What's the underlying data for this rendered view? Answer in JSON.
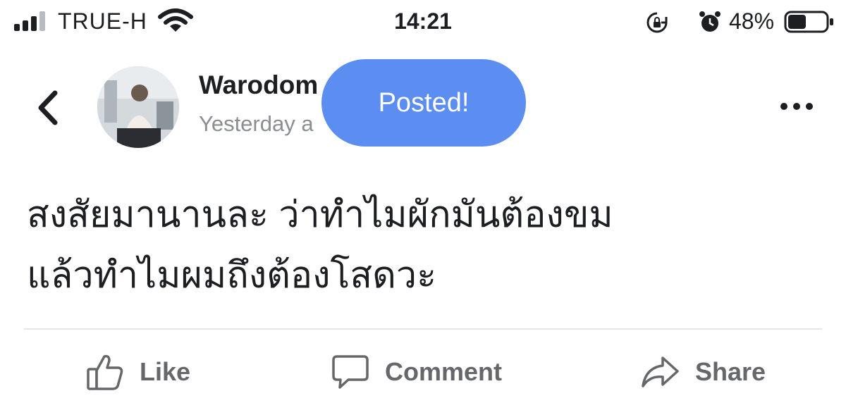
{
  "status_bar": {
    "carrier": "TRUE-H",
    "time": "14:21",
    "battery_percent": "48%",
    "battery_level": 0.48,
    "icons": [
      "signal-icon",
      "wifi-icon",
      "rotation-lock-icon",
      "alarm-icon",
      "battery-icon"
    ]
  },
  "header": {
    "author_name": "Warodom",
    "post_time": "Yesterday a",
    "back_icon": "back-chevron-icon",
    "more_icon": "more-dots-icon"
  },
  "toast": {
    "text": "Posted!",
    "color": "#5b8ef0"
  },
  "post": {
    "lines": [
      "สงสัยมานานละ ว่าทำไมผักมันต้องขม",
      "แล้วทำไมผมถึงต้องโสดวะ"
    ]
  },
  "actions": {
    "like": "Like",
    "comment": "Comment",
    "share": "Share"
  },
  "colors": {
    "text": "#1c1e21",
    "secondary_text": "#8a8d91",
    "action_text": "#65676b",
    "toast": "#5b8ef0"
  }
}
